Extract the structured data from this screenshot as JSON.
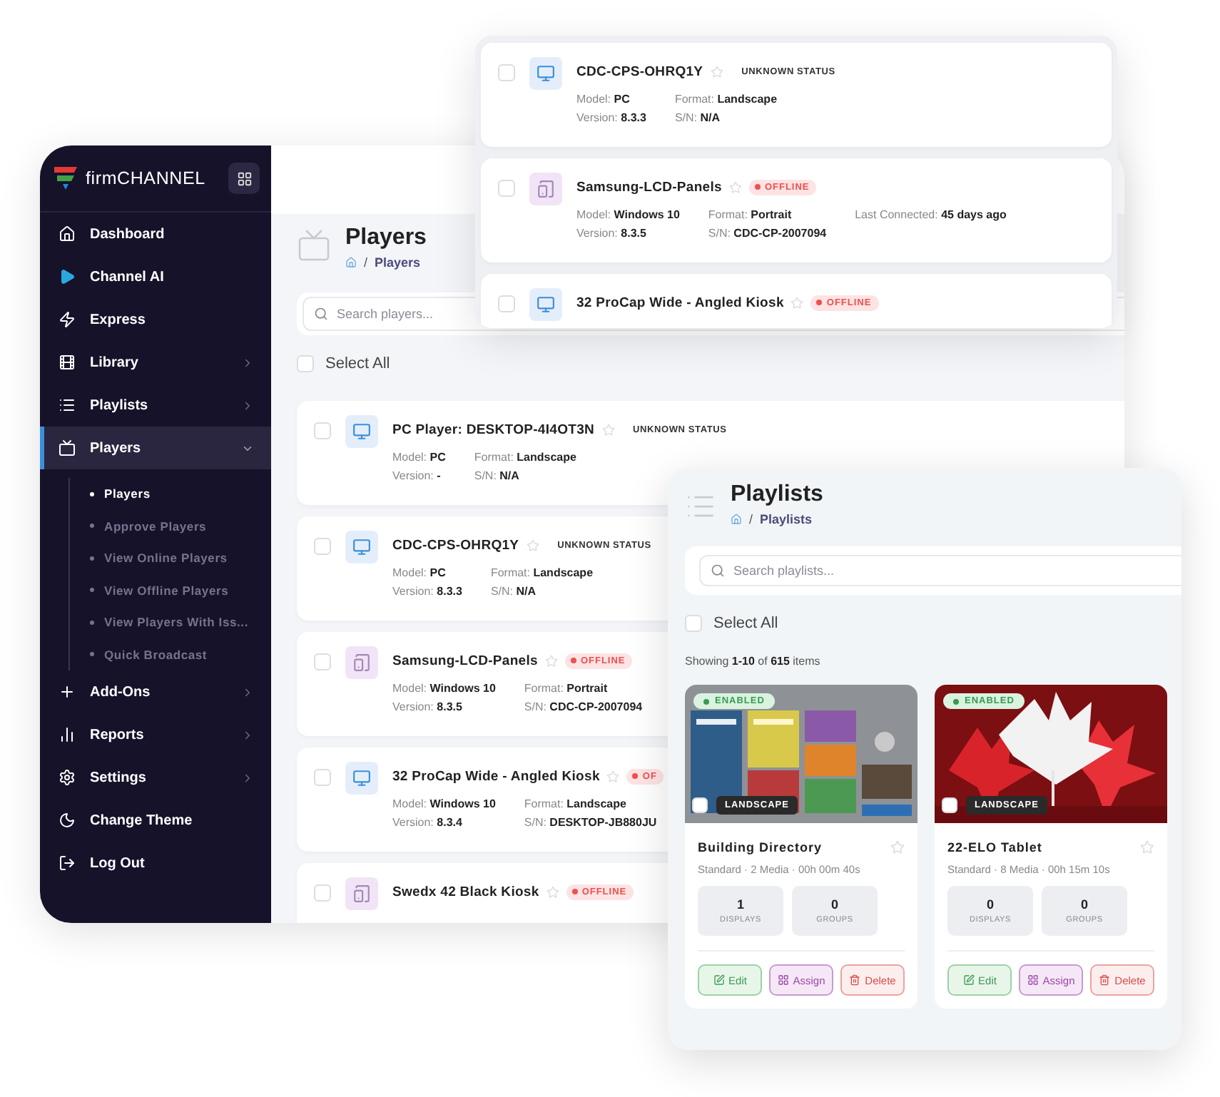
{
  "sidebar": {
    "logo": "firmCHANNEL",
    "items": [
      {
        "label": "Dashboard",
        "has_submenu": false,
        "selected": false
      },
      {
        "label": "Channel AI",
        "has_submenu": false,
        "selected": false
      },
      {
        "label": "Express",
        "has_submenu": false,
        "selected": false
      },
      {
        "label": "Library",
        "has_submenu": true,
        "expanded": false,
        "selected": false
      },
      {
        "label": "Playlists",
        "has_submenu": true,
        "expanded": false,
        "selected": false
      },
      {
        "label": "Players",
        "has_submenu": true,
        "expanded": true,
        "selected": true,
        "children": [
          {
            "label": "Players",
            "selected": true
          },
          {
            "label": "Approve Players",
            "selected": false
          },
          {
            "label": "View Online Players",
            "selected": false
          },
          {
            "label": "View Offline Players",
            "selected": false
          },
          {
            "label": "View Players With Iss...",
            "selected": false
          },
          {
            "label": "Quick Broadcast",
            "selected": false
          }
        ]
      },
      {
        "label": "Add-Ons",
        "has_submenu": true,
        "expanded": false,
        "selected": false
      },
      {
        "label": "Reports",
        "has_submenu": true,
        "expanded": false,
        "selected": false
      },
      {
        "label": "Settings",
        "has_submenu": true,
        "expanded": false,
        "selected": false
      },
      {
        "label": "Change Theme",
        "has_submenu": false,
        "selected": false
      },
      {
        "label": "Log Out",
        "has_submenu": false,
        "selected": false
      }
    ]
  },
  "players_page": {
    "title": "Players",
    "breadcrumb_separator": "/",
    "breadcrumb": "Players",
    "search": {
      "placeholder": "Search players..."
    },
    "select_all": {
      "label": "Select All",
      "checked": false
    },
    "players": [
      {
        "kind": "monitor",
        "name": "PC Player: DESKTOP-4I4OT3N",
        "checked": false,
        "status": {
          "kind": "unknown",
          "label": "UNKNOWN STATUS"
        },
        "lines": [
          [
            "Model: **PC**",
            "Format: **Landscape**"
          ],
          [
            "Version: **-**",
            "S/N: **N/A**"
          ]
        ]
      },
      {
        "kind": "monitor",
        "name": "CDC-CPS-OHRQ1Y",
        "checked": false,
        "status": {
          "kind": "unknown",
          "label": "UNKNOWN STATUS"
        },
        "lines": [
          [
            "Model: **PC**",
            "Format: **Landscape**"
          ],
          [
            "Version: **8.3.3**",
            "S/N: **N/A**"
          ]
        ]
      },
      {
        "kind": "tablet",
        "name": "Samsung-LCD-Panels",
        "checked": false,
        "status": {
          "kind": "offline",
          "label": "OFFLINE"
        },
        "lines": [
          [
            "Model: **Windows 10**",
            "Format: **Portrait**"
          ],
          [
            "Version: **8.3.5**",
            "S/N: **CDC-CP-2007094**"
          ]
        ]
      },
      {
        "kind": "monitor",
        "name": "32 ProCap Wide - Angled Kiosk",
        "checked": false,
        "status": {
          "kind": "offline",
          "label": "OF"
        },
        "lines": [
          [
            "Model: **Windows 10**",
            "Format: **Landscape**"
          ],
          [
            "Version: **8.3.4**",
            "S/N: **DESKTOP-JB880JU**"
          ]
        ]
      },
      {
        "kind": "tablet",
        "name": "Swedx 42 Black Kiosk",
        "checked": false,
        "status": {
          "kind": "offline",
          "label": "OFFLINE"
        }
      }
    ]
  },
  "players_popup": {
    "players": [
      {
        "kind": "monitor",
        "name": "CDC-CPS-OHRQ1Y",
        "checked": false,
        "status": {
          "kind": "unknown",
          "label": "UNKNOWN STATUS"
        },
        "lines": [
          [
            "Model: **PC**",
            "Format: **Landscape**"
          ],
          [
            "Version: **8.3.3**",
            "S/N: **N/A**"
          ]
        ]
      },
      {
        "kind": "tablet",
        "name": "Samsung-LCD-Panels",
        "checked": false,
        "status": {
          "kind": "offline",
          "label": "OFFLINE"
        },
        "lines": [
          [
            "Model: **Windows 10**",
            "Format: **Portrait**",
            "Last Connected: **45 days ago**"
          ],
          [
            "Version: **8.3.5**",
            "S/N: **CDC-CP-2007094**"
          ]
        ]
      },
      {
        "kind": "monitor",
        "name": "32 ProCap Wide - Angled Kiosk",
        "checked": false,
        "status": {
          "kind": "offline",
          "label": "OFFLINE"
        }
      }
    ]
  },
  "playlists_page": {
    "title": "Playlists",
    "breadcrumb_separator": "/",
    "breadcrumb": "Playlists",
    "search": {
      "placeholder": "Search playlists..."
    },
    "select_all": {
      "label": "Select All",
      "checked": false
    },
    "showing": "Showing **1-10** of **615** items",
    "cards": [
      {
        "name": "Building Directory",
        "status": "ENABLED",
        "orientation": "LANDSCAPE",
        "checked": false,
        "meta": "Standard · 2 Media · 00h 00m 40s",
        "stats": [
          {
            "value": "1",
            "label": "DISPLAYS"
          },
          {
            "value": "0",
            "label": "GROUPS"
          }
        ],
        "actions": [
          {
            "kind": "edit",
            "label": "Edit"
          },
          {
            "kind": "assign",
            "label": "Assign"
          },
          {
            "kind": "delete",
            "label": "Delete"
          }
        ]
      },
      {
        "name": "22-ELO Tablet",
        "status": "ENABLED",
        "orientation": "LANDSCAPE",
        "checked": false,
        "meta": "Standard · 8 Media · 00h 15m 10s",
        "stats": [
          {
            "value": "0",
            "label": "DISPLAYS"
          },
          {
            "value": "0",
            "label": "GROUPS"
          }
        ],
        "actions": [
          {
            "kind": "edit",
            "label": "Edit"
          },
          {
            "kind": "assign",
            "label": "Assign"
          },
          {
            "kind": "delete",
            "label": "Delete"
          }
        ]
      }
    ]
  }
}
